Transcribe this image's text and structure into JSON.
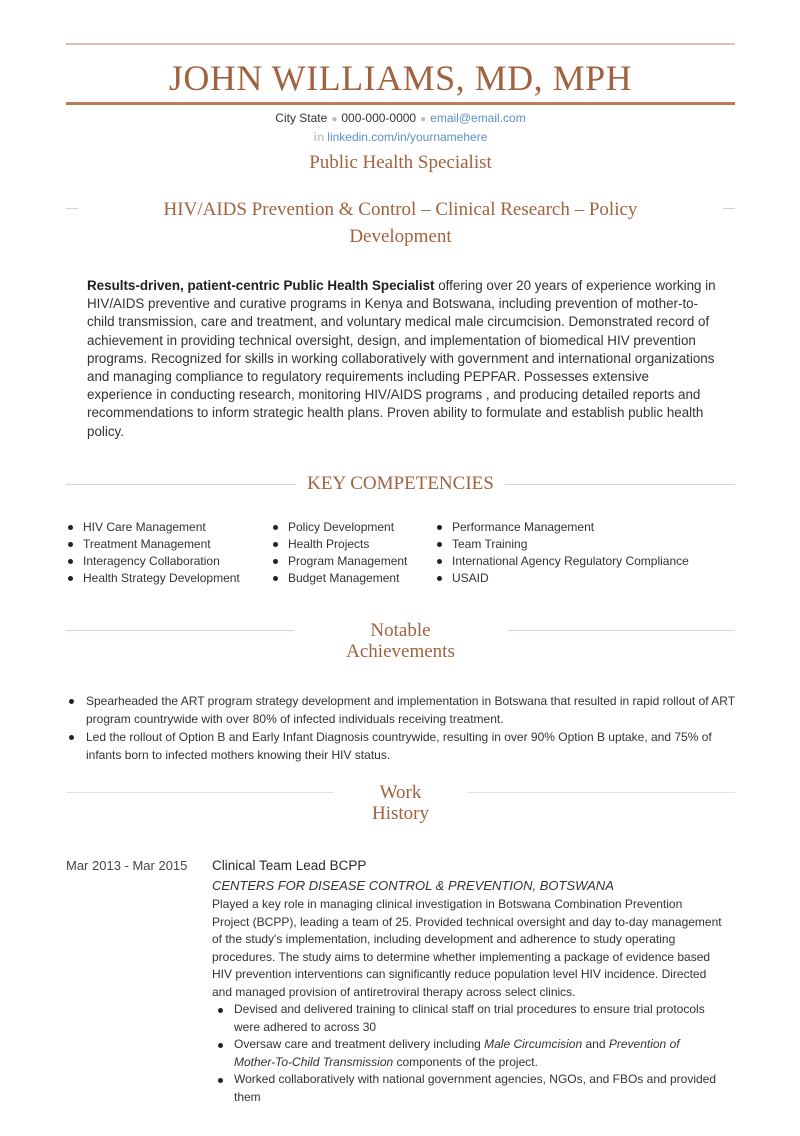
{
  "header": {
    "name": "JOHN WILLIAMS, MD, MPH",
    "contact": {
      "location": "City State",
      "phone": "000-000-0000",
      "email": "email@email.com",
      "separator": "●",
      "linkedin_icon": "in",
      "linkedin": "linkedin.com/in/yournamehere"
    },
    "job_title": "Public Health Specialist",
    "tagline": "HIV/AIDS Prevention & Control – Clinical Research – Policy Development"
  },
  "summary": {
    "lead": "Results-driven, patient-centric Public Health Specialist",
    "text": " offering over 20 years of experience working in HIV/AIDS preventive and curative programs in Kenya and Botswana, including prevention of mother-to-child transmission, care and treatment, and voluntary medical male circumcision.  Demonstrated record of achievement in providing technical oversight, design, and implementation of biomedical HIV prevention programs. Recognized for skills in working collaboratively with government and international organizations and managing compliance to regulatory requirements including PEPFAR. Possesses extensive experience in conducting research, monitoring HIV/AIDS programs , and producing detailed reports and recommendations to inform strategic health plans. Proven ability to formulate and establish public health policy."
  },
  "competencies": {
    "title": "KEY COMPETENCIES",
    "columns": [
      [
        "HIV Care Management",
        "Treatment Management",
        "Interagency Collaboration",
        "Health Strategy Development"
      ],
      [
        "Policy Development",
        "Health Projects",
        "Program Management",
        "Budget Management"
      ],
      [
        "Performance Management",
        "Team Training",
        "International Agency Regulatory Compliance",
        "USAID"
      ]
    ]
  },
  "achievements": {
    "title_line1": "Notable",
    "title_line2": "Achievements",
    "items": [
      "Spearheaded the ART program strategy development and implementation in Botswana that resulted in rapid rollout of ART program countrywide with over 80% of infected individuals receiving treatment.",
      "Led the rollout of Option B and Early Infant Diagnosis countrywide, resulting in over 90% Option B uptake, and 75% of infants born to infected mothers knowing their HIV status."
    ]
  },
  "work": {
    "title_line1": "Work",
    "title_line2": "History",
    "jobs": [
      {
        "dates": "Mar 2013 - Mar 2015",
        "title": "Clinical Team Lead BCPP",
        "org": "CENTERS FOR DISEASE CONTROL & PREVENTION, BOTSWANA",
        "description": "Played a key role in managing clinical investigation in Botswana Combination Prevention Project (BCPP), leading a team of 25. Provided technical oversight and day to-day management of the study's implementation, including development and adherence to study operating procedures.  The study aims to determine whether implementing a package of evidence based HIV prevention interventions can significantly reduce population level HIV incidence. Directed and managed provision of antiretroviral therapy across select clinics.",
        "bullets": [
          {
            "text": "Devised and delivered training to clinical staff on trial procedures to ensure trial protocols were adhered to across 30"
          },
          {
            "pre": "Oversaw care and treatment delivery including ",
            "em1": "Male Circumcision",
            "mid": " and ",
            "em2": "Prevention of Mother-To-Child Transmission",
            "post": " components of the project."
          },
          {
            "text": "Worked collaboratively with national government agencies, NGOs, and FBOs and provided them"
          }
        ]
      }
    ]
  }
}
